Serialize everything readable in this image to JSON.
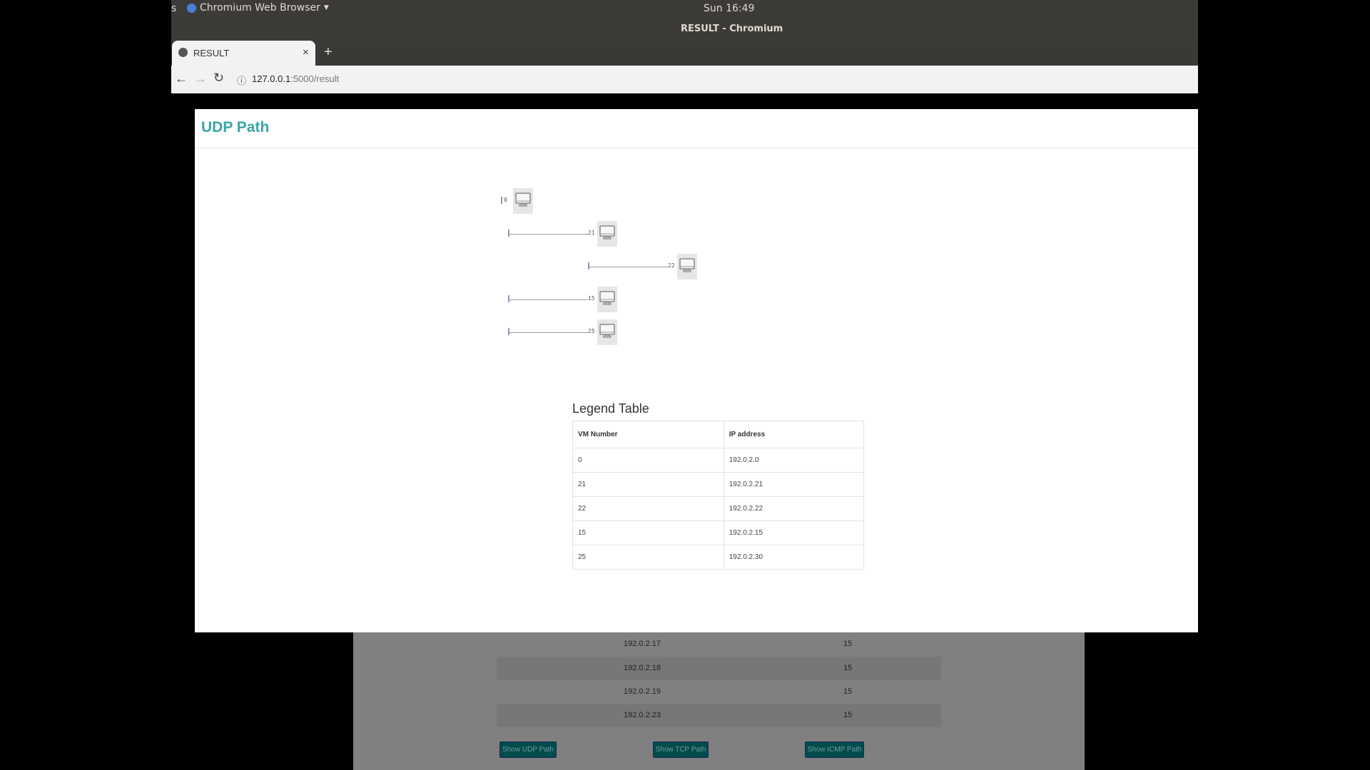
{
  "system": {
    "activities_partial": "s",
    "app_menu": "Chromium Web Browser",
    "clock": "Sun 16:49"
  },
  "window": {
    "title": "RESULT - Chromium"
  },
  "tab": {
    "label": "RESULT",
    "close": "×",
    "new_tab": "+"
  },
  "address": {
    "host": "127.0.0.1",
    "path": ":5000/result"
  },
  "modal": {
    "title": "UDP Path",
    "nodes": [
      {
        "label": "0",
        "depth": 0
      },
      {
        "label": "21",
        "depth": 1
      },
      {
        "label": "22",
        "depth": 2
      },
      {
        "label": "15",
        "depth": 1
      },
      {
        "label": "25",
        "depth": 1
      }
    ],
    "legend": {
      "title": "Legend Table",
      "headers": [
        "VM Number",
        "IP address"
      ],
      "rows": [
        [
          "0",
          "192.0.2.0"
        ],
        [
          "21",
          "192.0.2.21"
        ],
        [
          "22",
          "192.0.2.22"
        ],
        [
          "15",
          "192.0.2.15"
        ],
        [
          "25",
          "192.0.2.30"
        ]
      ]
    }
  },
  "background": {
    "rows": [
      [
        "192.0.2.17",
        "15"
      ],
      [
        "192.0.2.18",
        "15"
      ],
      [
        "192.0.2.19",
        "15"
      ],
      [
        "192.0.2.23",
        "15"
      ]
    ],
    "buttons": [
      "Show UDP Path",
      "Show TCP Path",
      "Show ICMP Path"
    ]
  },
  "colors": {
    "accent": "#3aa6a6",
    "button": "#009999"
  }
}
